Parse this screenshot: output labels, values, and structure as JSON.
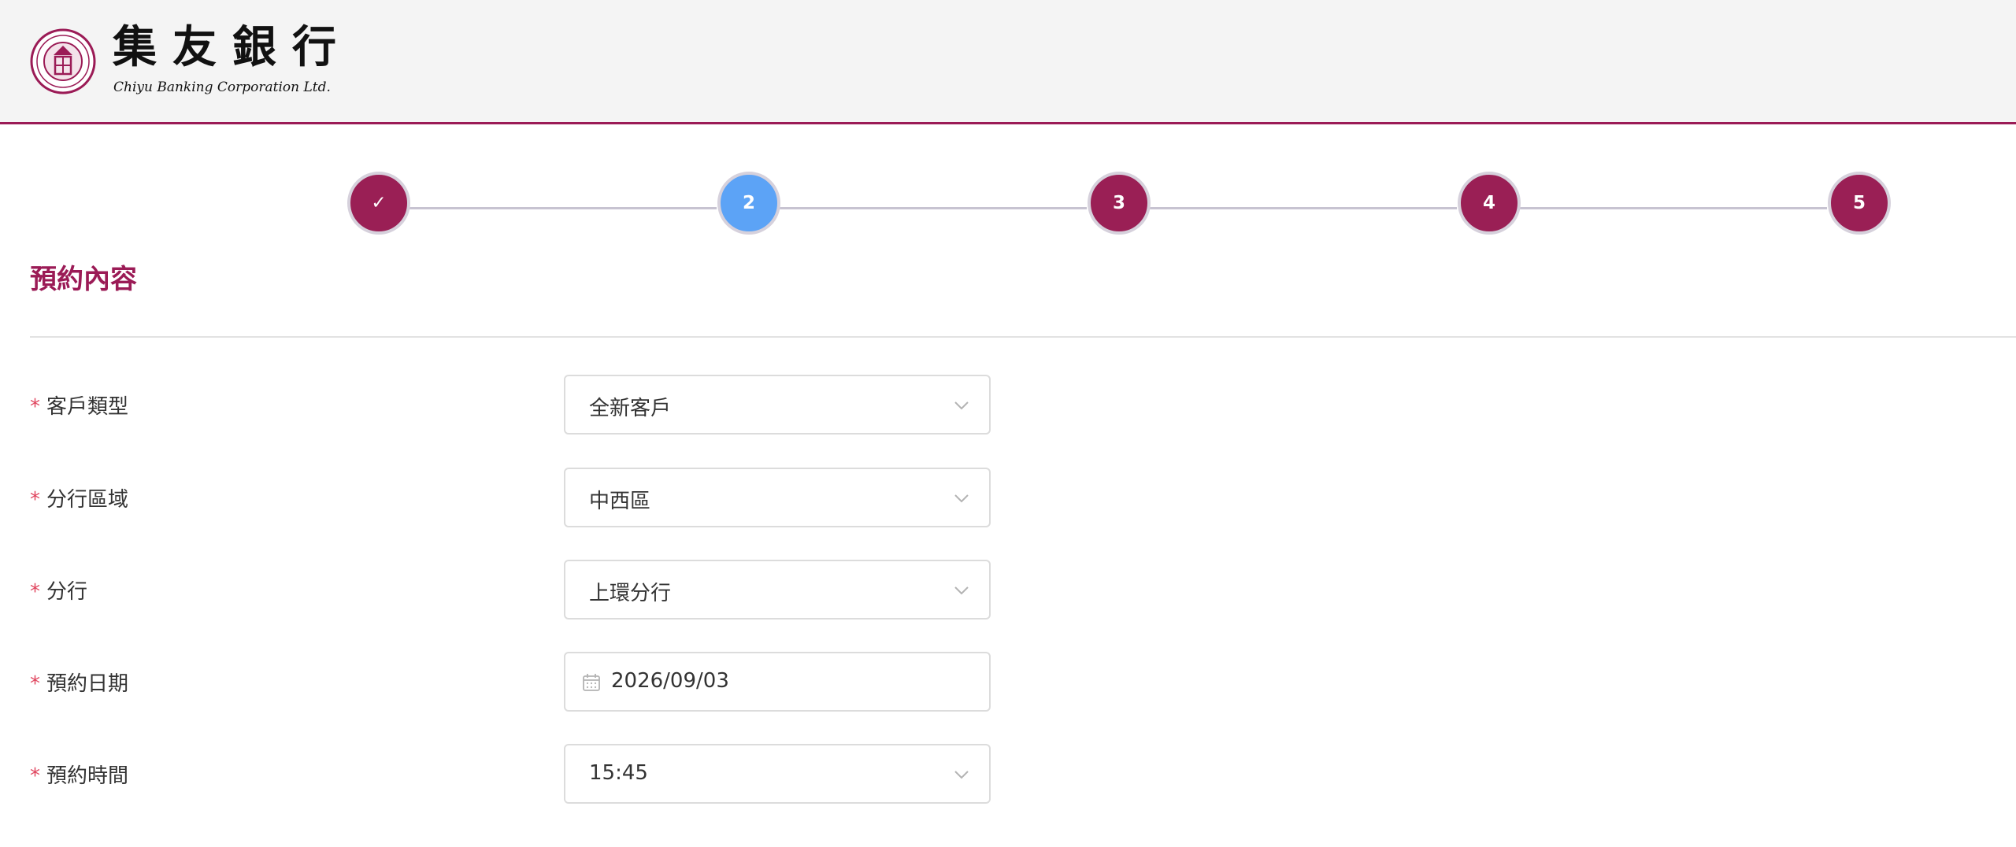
{
  "header": {
    "logo_cn": "集友銀行",
    "logo_en": "Chiyu Banking Corporation Ltd.",
    "seal_icon": "bank-seal-icon",
    "accent_color": "#9b1b56"
  },
  "stepper": {
    "steps": [
      {
        "label": "✓",
        "state": "completed"
      },
      {
        "label": "2",
        "state": "active"
      },
      {
        "label": "3",
        "state": "pending"
      },
      {
        "label": "4",
        "state": "pending"
      },
      {
        "label": "5",
        "state": "pending"
      }
    ],
    "active_color": "#5ca3f6",
    "step_color": "#9a1f55"
  },
  "section": {
    "title": "預約內容"
  },
  "form": {
    "required_mark": "*",
    "customer_type": {
      "label": "客戶類型",
      "value": "全新客戶"
    },
    "branch_region": {
      "label": "分行區域",
      "value": "中西區"
    },
    "branch": {
      "label": "分行",
      "value": "上環分行"
    },
    "appointment_date": {
      "label": "預約日期",
      "value": "2026/09/03"
    },
    "appointment_time": {
      "label": "預約時間",
      "value": "15:45"
    }
  }
}
